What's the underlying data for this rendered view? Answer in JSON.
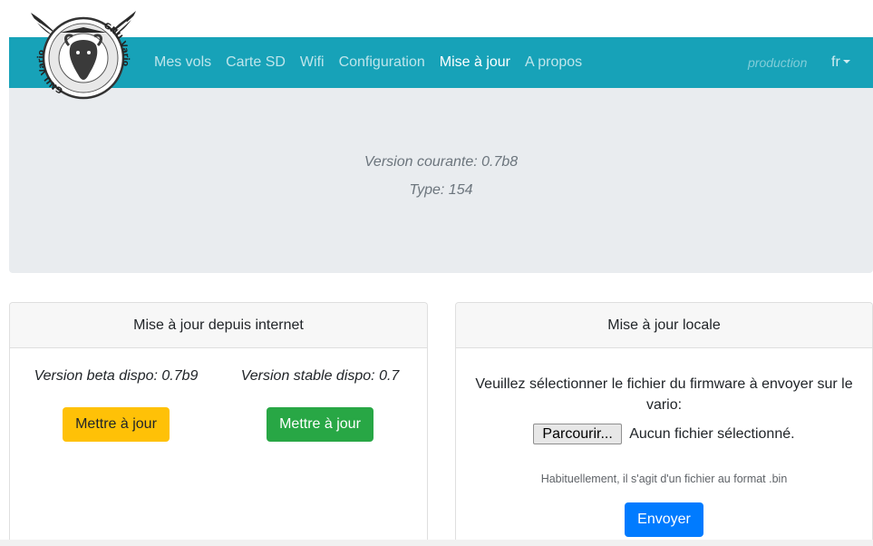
{
  "brand": {
    "logo_text": "GNU Vario"
  },
  "nav": {
    "items": [
      {
        "label": "Mes vols",
        "active": false
      },
      {
        "label": "Carte SD",
        "active": false
      },
      {
        "label": "Wifi",
        "active": false
      },
      {
        "label": "Configuration",
        "active": false
      },
      {
        "label": "Mise à jour",
        "active": true
      },
      {
        "label": "A propos",
        "active": false
      }
    ],
    "env_label": "production",
    "language": "fr"
  },
  "jumbotron": {
    "current_version": "Version courante: 0.7b8",
    "type": "Type: 154"
  },
  "internet_update": {
    "header": "Mise à jour depuis internet",
    "beta_text": "Version beta dispo: 0.7b9",
    "beta_button": "Mettre à jour",
    "stable_text": "Version stable dispo: 0.7",
    "stable_button": "Mettre à jour"
  },
  "local_update": {
    "header": "Mise à jour locale",
    "prompt": "Veuillez sélectionner le fichier du firmware à envoyer sur le vario:",
    "browse_button": "Parcourir...",
    "file_status": "Aucun fichier sélectionné.",
    "hint": "Habituellement, il s'agit d'un fichier au format .bin",
    "send_button": "Envoyer"
  },
  "colors": {
    "navbar": "#17a2b8",
    "jumbotron": "#e9ecef",
    "warning": "#ffc107",
    "success": "#28a745",
    "primary": "#007bff"
  }
}
